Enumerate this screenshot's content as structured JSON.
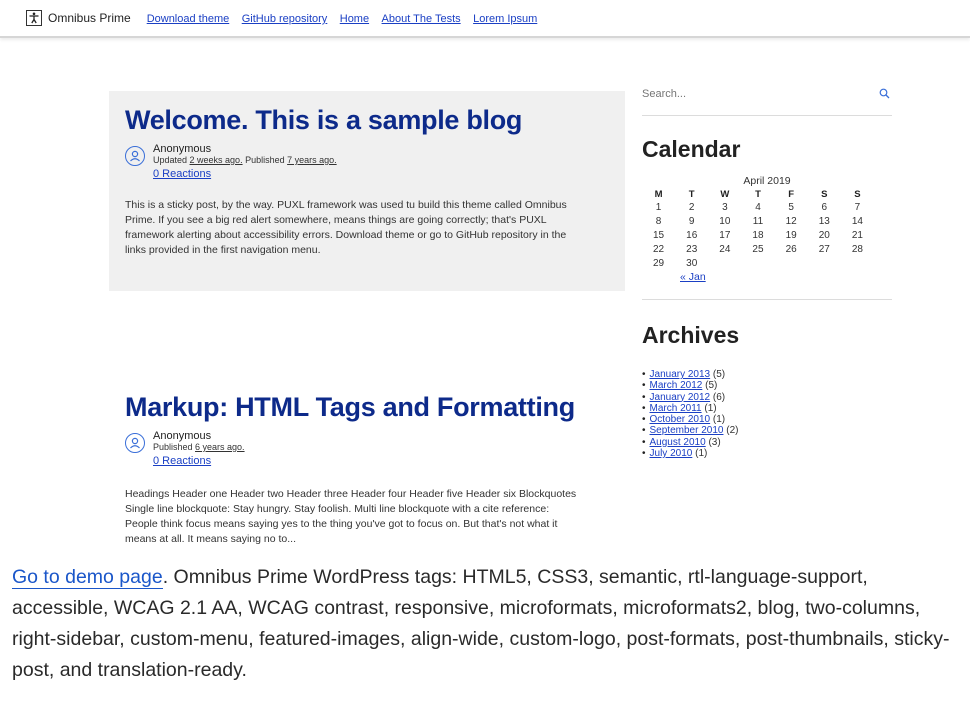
{
  "header": {
    "site_title": "Omnibus Prime",
    "nav": [
      "Download theme",
      "GitHub repository",
      "Home",
      "About The Tests",
      "Lorem Ipsum"
    ]
  },
  "posts": [
    {
      "title": "Welcome. This is a sample blog",
      "author": "Anonymous",
      "updated_prefix": "Updated ",
      "updated": "2 weeks ago.",
      "published_prefix": " Published ",
      "published": "7 years ago.",
      "reactions": "0 Reactions",
      "excerpt": "This is a sticky post, by the way. PUXL framework was used tu build this theme called Omnibus Prime. If you see a big red alert somewhere, means things are going correctly; that's PUXL framework alerting about accessibility errors. Download theme or go to GitHub repository in the links provided in the first navigation menu."
    },
    {
      "title": "Markup: HTML Tags and Formatting",
      "author": "Anonymous",
      "published_prefix": "Published ",
      "published": "6 years ago.",
      "reactions": "0 Reactions",
      "excerpt": "Headings Header one Header two Header three Header four Header five Header six Blockquotes Single line blockquote: Stay hungry. Stay foolish. Multi line blockquote with a cite reference: People think focus means saying yes to the thing you've got to focus on. But that's not what it means at all. It means saying no to..."
    }
  ],
  "sidebar": {
    "search_placeholder": "Search...",
    "calendar": {
      "title": "Calendar",
      "caption": "April 2019",
      "weekdays": [
        "M",
        "T",
        "W",
        "T",
        "F",
        "S",
        "S"
      ],
      "weeks": [
        [
          "1",
          "2",
          "3",
          "4",
          "5",
          "6",
          "7"
        ],
        [
          "8",
          "9",
          "10",
          "11",
          "12",
          "13",
          "14"
        ],
        [
          "15",
          "16",
          "17",
          "18",
          "19",
          "20",
          "21"
        ],
        [
          "22",
          "23",
          "24",
          "25",
          "26",
          "27",
          "28"
        ],
        [
          "29",
          "30",
          "",
          "",
          "",
          "",
          ""
        ]
      ],
      "prev_link": "« Jan"
    },
    "archives": {
      "title": "Archives",
      "items": [
        {
          "label": "January 2013",
          "count": "(5)"
        },
        {
          "label": "March 2012",
          "count": "(5)"
        },
        {
          "label": "January 2012",
          "count": "(6)"
        },
        {
          "label": "March 2011",
          "count": "(1)"
        },
        {
          "label": "October 2010",
          "count": "(1)"
        },
        {
          "label": "September 2010",
          "count": "(2)"
        },
        {
          "label": "August 2010",
          "count": "(3)"
        },
        {
          "label": "July 2010",
          "count": "(1)"
        }
      ]
    }
  },
  "caption": {
    "link": "Go to demo page",
    "text": ". Omnibus Prime WordPress tags: HTML5, CSS3, semantic, rtl-language-support, accessible, WCAG 2.1 AA, WCAG contrast, responsive, microformats, microformats2, blog, two-columns, right-sidebar, custom-menu, featured-images, align-wide, custom-logo, post-formats, post-thumbnails, sticky-post, and translation-ready."
  },
  "colors": {
    "title_blue": "#0d2a8a",
    "link_blue": "#1a3fc4",
    "sticky_bg": "#f0f0f0"
  }
}
